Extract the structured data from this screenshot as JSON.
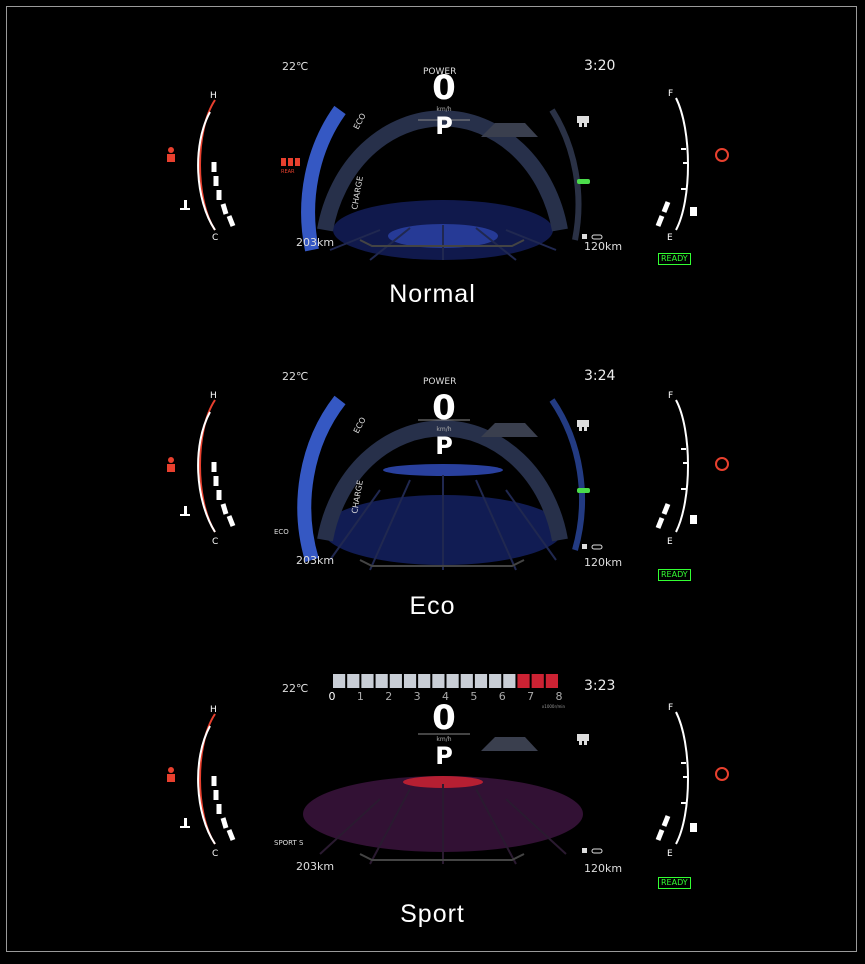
{
  "panels": [
    {
      "mode": "normal",
      "caption": "Normal",
      "temperature": "22℃",
      "clock": "3:20",
      "speed": "0",
      "speed_unit": "km/h",
      "gear": "P",
      "range_left": "203km",
      "range_right": "120km",
      "status": "READY",
      "arc_top_label": "POWER",
      "arc_eco_label": "ECO",
      "arc_charge_label": "CHARGE",
      "rear_label": "REAR",
      "mode_tag": ""
    },
    {
      "mode": "eco",
      "caption": "Eco",
      "temperature": "22℃",
      "clock": "3:24",
      "speed": "0",
      "speed_unit": "km/h",
      "gear": "P",
      "range_left": "203km",
      "range_right": "120km",
      "status": "READY",
      "arc_top_label": "POWER",
      "arc_eco_label": "ECO",
      "arc_charge_label": "CHARGE",
      "mode_tag": "ECO"
    },
    {
      "mode": "sport",
      "caption": "Sport",
      "temperature": "22℃",
      "clock": "3:23",
      "speed": "0",
      "speed_unit": "km/h",
      "gear": "P",
      "range_left": "203km",
      "range_right": "120km",
      "status": "READY",
      "mode_tag": "SPORT S",
      "tach_ticks": [
        "0",
        "1",
        "2",
        "3",
        "4",
        "5",
        "6",
        "7",
        "8"
      ],
      "tach_unit": "x1000r/min",
      "tach_redline_from": 6.2
    }
  ],
  "temp_gauge": {
    "hot_label": "H",
    "cold_label": "C"
  },
  "fuel_gauge": {
    "full_label": "F",
    "empty_label": "E"
  },
  "colors": {
    "warning": "#e8402e",
    "eco_blue": "#3b62d8",
    "sport_red": "#cc2233",
    "ready_green": "#33ee33",
    "car_green": "#4bdc4b"
  },
  "icons": [
    "coolant-temp-icon",
    "seatbelt-warning-icon",
    "parking-brake-icon",
    "fuel-pump-icon",
    "rear-seatbelt-icon",
    "car-status-icon",
    "eco-car-icon",
    "range-icon"
  ]
}
